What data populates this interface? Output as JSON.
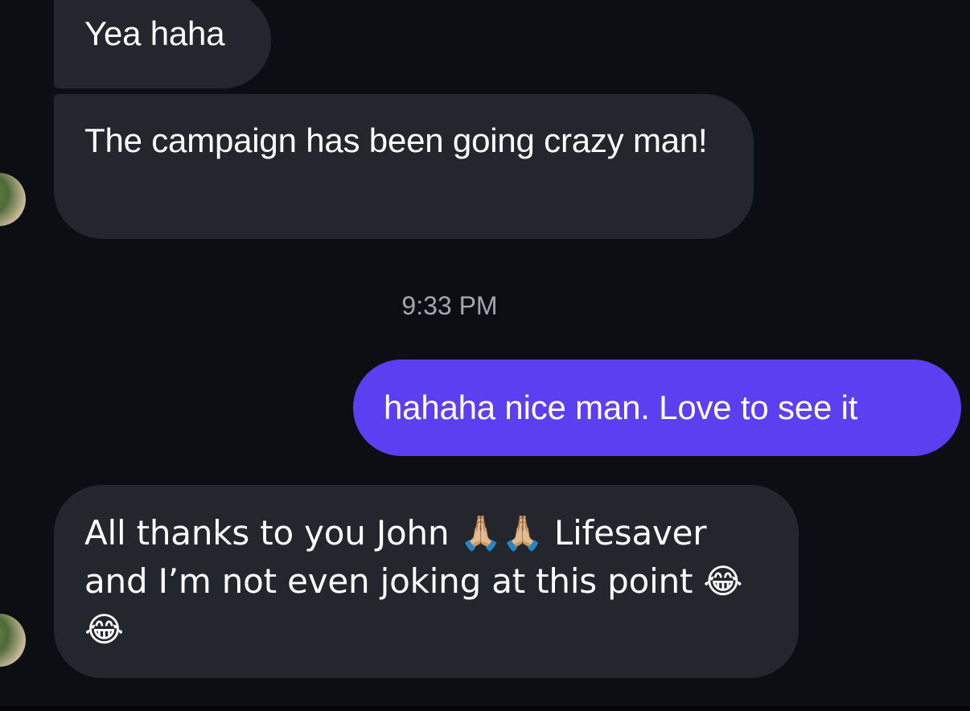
{
  "conversation": {
    "messages": [
      {
        "direction": "received",
        "text": "Yea haha"
      },
      {
        "direction": "received",
        "text": "The campaign has been going crazy man!"
      },
      {
        "direction": "sent",
        "text": "hahaha nice man. Love to see it"
      },
      {
        "direction": "received",
        "text": "All thanks to you John 🙏🏼🙏🏼 Lifesaver and I’m not even joking at this point 😂😂"
      }
    ],
    "timestamp": "9:33 PM"
  },
  "colors": {
    "background": "#0d0e14",
    "received_bubble": "#24262e",
    "sent_bubble": "#5b3ff0",
    "timestamp_text": "#a4a6ae"
  }
}
